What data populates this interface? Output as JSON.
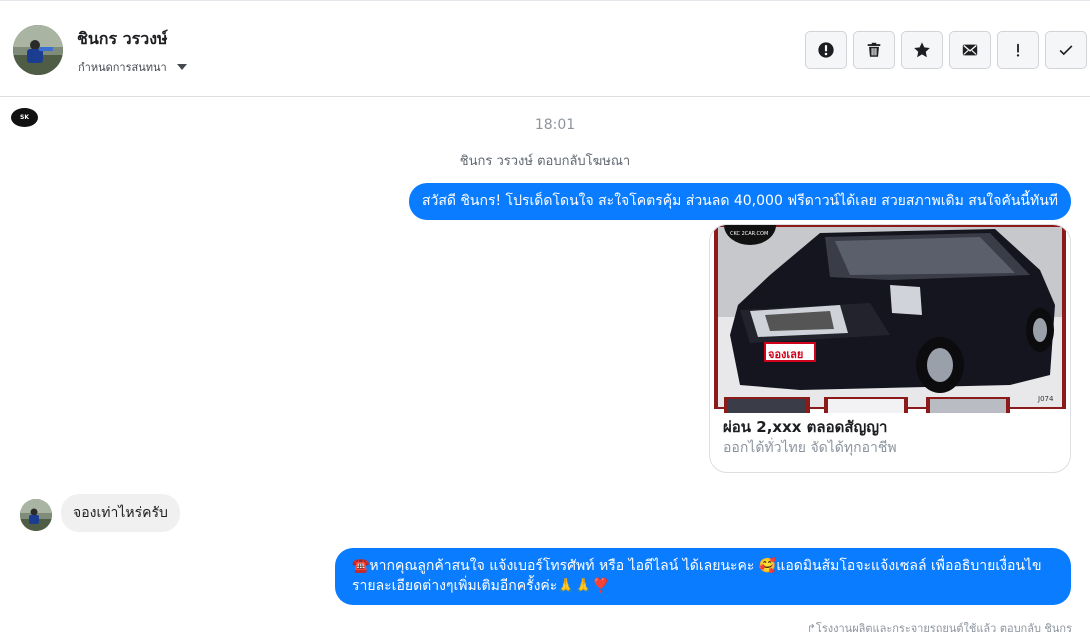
{
  "header": {
    "contact_name": "ชินกร วรวงษ์",
    "assign_label": "กำหนดการสนทนา",
    "toolbar": [
      {
        "name": "spam-button",
        "icon": "alert-circle-icon"
      },
      {
        "name": "delete-button",
        "icon": "trash-icon"
      },
      {
        "name": "star-button",
        "icon": "star-icon"
      },
      {
        "name": "mark-unread-button",
        "icon": "envelope-icon"
      },
      {
        "name": "follow-up-button",
        "icon": "exclamation-icon"
      },
      {
        "name": "mark-done-button",
        "icon": "check-icon"
      }
    ]
  },
  "thread": {
    "page_logo_text": "SK",
    "timestamp": "18:01",
    "reply_note": "ชินกร วรวงษ์ ตอบกลับโฆษณา",
    "message_1": "สวัสดี ชินกร! โปรเด็ดโดนใจ สะใจโคตรคุ้ม ส่วนลด 40,000 ฟรีดาวน์ได้เลย สวยสภาพเดิม สนใจคันนี้ทันที",
    "ad_card": {
      "title": "ผ่อน 2,xxx ตลอดสัญญา",
      "subtitle": "ออกได้ทั่วไทย จัดได้ทุกอาชีพ",
      "image_badge": "จองเลย",
      "image_watermark": "CKC 2CAR.COM",
      "image_plate": "J074"
    },
    "customer_message": "จองเท่าไหร่ครับ",
    "message_2": "☎️หากคุณลูกค้าสนใจ แจ้งเบอร์โทรศัพท์ หรือ ไอดีไลน์  ได้เลยนะคะ 🥰แอดมินส้มโอจะแจ้งเซลล์   เพื่ออธิบายเงื่อนไขรายละเอียดต่างๆเพิ่มเติมอีกครั้งค่ะ🙏🙏❣️",
    "footer_note": "↱โรงงานผลิตและกระจายรถยนต์ใช้แล้ว ตอบกลับ ชินกร"
  },
  "colors": {
    "outgoing_bubble": "#0a7cff",
    "incoming_bubble": "#f0f0f0",
    "badge_red": "#d0021b"
  }
}
